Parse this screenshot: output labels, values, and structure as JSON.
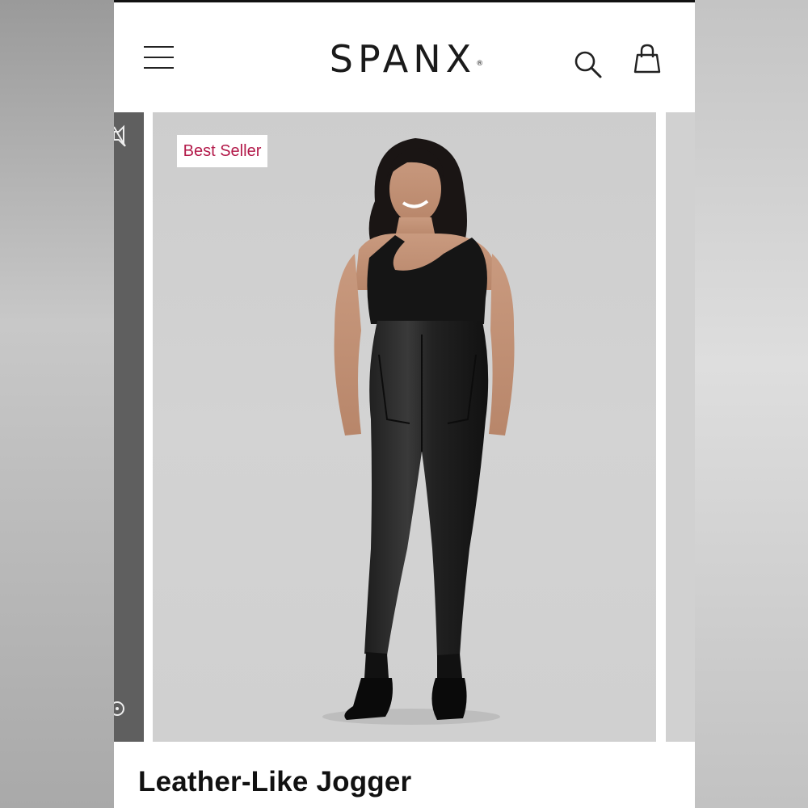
{
  "header": {
    "logo": "SPANX",
    "logo_mark": "®",
    "menu_icon": "hamburger-menu-icon",
    "search_icon": "search-icon",
    "bag_icon": "shopping-bag-icon"
  },
  "gallery": {
    "badge": "Best Seller",
    "left_peek_icons": [
      "mute-icon",
      "info-icon"
    ],
    "image_description_icon": "product-model-image"
  },
  "product": {
    "title": "Leather-Like Jogger"
  },
  "colors": {
    "badge_text": "#b31a4a",
    "text": "#111111",
    "image_bg": "#d0d0d0"
  }
}
